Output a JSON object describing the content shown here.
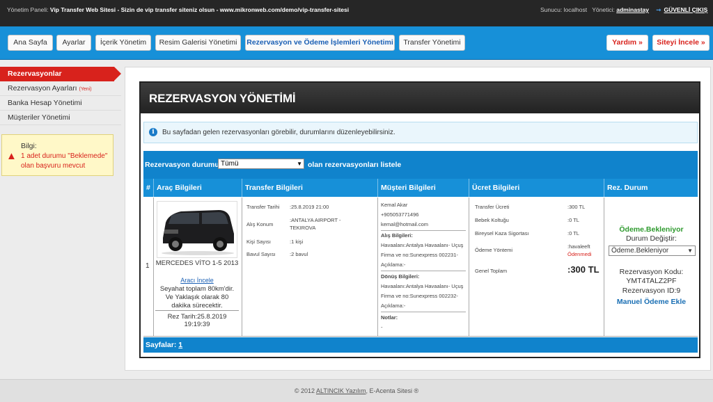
{
  "topbar": {
    "panel_label": "Yönetim Paneli:",
    "site_title": "Vip Transfer Web Sitesi - Sizin de vip transfer siteniz olsun - www.mikronweb.com/demo/vip-transfer-sitesi",
    "server_label": "Sunucu:",
    "server_value": "localhost",
    "admin_label": "Yönetici:",
    "admin_value": "adminastay",
    "logout": "GÜVENLİ ÇIKIŞ"
  },
  "nav": {
    "items": [
      "Ana Sayfa",
      "Ayarlar",
      "İçerik Yönetim",
      "Resim Galerisi Yönetimi",
      "Rezervasyon ve Ödeme İşlemleri Yönetimi",
      "Transfer Yönetimi"
    ],
    "active": "Rezervasyon ve Ödeme İşlemleri Yönetimi",
    "help": "Yardım »",
    "view_site": "Siteyi İncele »"
  },
  "sidebar": {
    "items": [
      {
        "label": "Rezervasyonlar",
        "active": true
      },
      {
        "label": "Rezervasyon Ayarları",
        "badge": "(Yeni)"
      },
      {
        "label": "Banka Hesap Yönetimi"
      },
      {
        "label": "Müşteriler Yönetimi"
      }
    ],
    "info_label": "Bilgi:",
    "info_link": "1 adet durumu \"Beklemede\" olan başvuru mevcut"
  },
  "panel": {
    "title": "REZERVASYON YÖNETİMİ",
    "notice": "Bu sayfadan gelen rezervasyonları görebilir, durumlarını düzenleyebilirsiniz.",
    "filter_label": "Rezervasyon durumu",
    "filter_value": "Tümü",
    "filter_suffix": "olan rezervasyonları listele",
    "columns": [
      "#",
      "Araç Bilgileri",
      "Transfer Bilgileri",
      "Müşteri Bilgileri",
      "Ücret Bilgileri",
      "Rez. Durum"
    ],
    "pager_label": "Sayfalar:",
    "pager_page": "1"
  },
  "row": {
    "no": "1",
    "vehicle": {
      "name": "MERCEDES VİTO 1-5 2013",
      "link": "Aracı İncele",
      "desc": "Seyahat toplam 80km'dir. Ve Yaklaşık olarak 80 dakika sürecektir.",
      "rez_date": "Rez Tarih:25.8.2019 19:19:39"
    },
    "transfer": [
      {
        "k": "Transfer Tarihi",
        "v": ":25.8.2019 21:00"
      },
      {
        "k": "Alış Konum",
        "v": ":ANTALYA AIRPORT - TEKIROVA"
      },
      {
        "k": "Kişi Sayısı",
        "v": ":1 kişi"
      },
      {
        "k": "Bavul Sayısı",
        "v": ":2 bavul"
      }
    ],
    "customer": {
      "name": "Kemal Akar",
      "phone": "+905053771496",
      "email": "kemal@hotmail.com",
      "pickup_title": "Alış Bilgileri:",
      "pickup_1": "Havaalanı:Antalya Havaalanı- Uçuş",
      "pickup_2": "Firma ve no:Sunexpress 002231-",
      "pickup_3": "Açıklama:-",
      "return_title": "Dönüş Bilgileri:",
      "return_1": "Havaalanı:Antalya Havaalanı- Uçuş",
      "return_2": "Firma ve no:Sunexpress 002232-",
      "return_3": "Açıklama:-",
      "notes_title": "Notlar:",
      "notes": "-"
    },
    "price": [
      {
        "k": "Transfer Ücreti",
        "v": ":300 TL"
      },
      {
        "k": "Bebek Koltuğu",
        "v": ":0 TL"
      },
      {
        "k": "Bireysel Kaza Sigortası",
        "v": ":0 TL"
      },
      {
        "k": "Ödeme Yöntemi",
        "v": ":havaleeft",
        "v2": "Ödenmedi"
      },
      {
        "k": "Genel Toplam",
        "v": ":300 TL"
      }
    ],
    "status": {
      "current": "Ödeme.Bekleniyor",
      "change_label": "Durum Değiştir:",
      "select_value": "Ödeme.Bekleniyor",
      "code_label": "Rezervasyon Kodu:",
      "code": "YMT4TALZ2PF",
      "id_label": "Rezervasyon ID:",
      "id": "9",
      "manual_payment": "Manuel Ödeme Ekle"
    }
  },
  "footer": {
    "copy": "© 2012",
    "link": "ALTINCIK Yazılım",
    "suffix": ", E-Acenta Sitesi ®"
  },
  "colors": {
    "accent": "#1790d8",
    "danger": "#d8221c",
    "success": "#2e9a2e"
  }
}
